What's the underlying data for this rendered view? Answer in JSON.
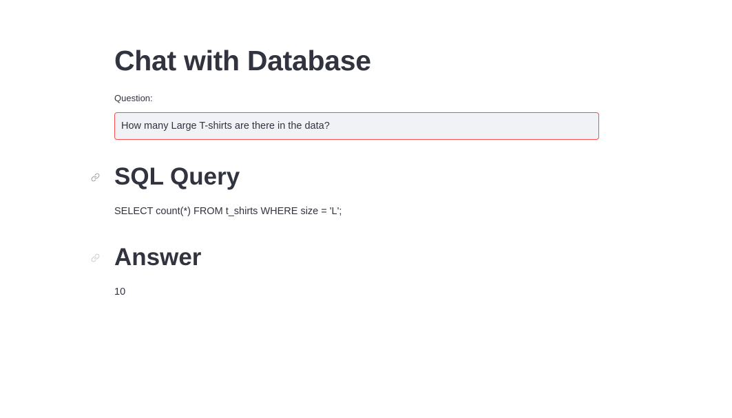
{
  "page": {
    "title": "Chat with Database"
  },
  "question": {
    "label": "Question:",
    "value": "How many Large T-shirts are there in the data?"
  },
  "sql_section": {
    "heading": "SQL Query",
    "anchor_icon": "link-icon",
    "query": "SELECT count(*) FROM t_shirts WHERE size = 'L';"
  },
  "answer_section": {
    "heading": "Answer",
    "anchor_icon": "link-icon",
    "value": "10"
  },
  "colors": {
    "text": "#31333f",
    "input_background": "#f0f2f6",
    "input_focus_border": "#ff4b4b",
    "background": "#ffffff"
  }
}
